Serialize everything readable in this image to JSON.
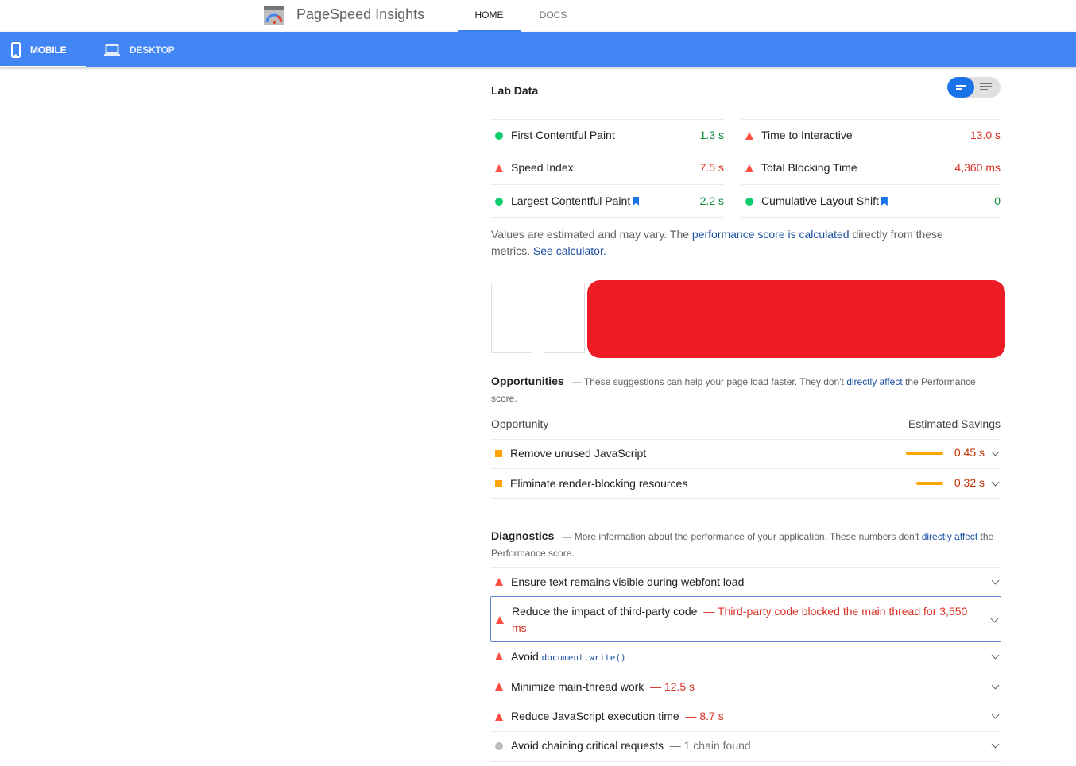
{
  "header": {
    "app_title": "PageSpeed Insights",
    "nav": [
      {
        "label": "HOME",
        "active": true
      },
      {
        "label": "DOCS",
        "active": false
      }
    ]
  },
  "device_tabs": [
    {
      "label": "MOBILE",
      "active": true,
      "icon": "phone-icon"
    },
    {
      "label": "DESKTOP",
      "active": false,
      "icon": "laptop-icon"
    }
  ],
  "lab_data": {
    "title": "Lab Data",
    "metrics": [
      {
        "label": "First Contentful Paint",
        "value": "1.3 s",
        "status": "pass",
        "bookmark": false
      },
      {
        "label": "Time to Interactive",
        "value": "13.0 s",
        "status": "fail",
        "bookmark": false
      },
      {
        "label": "Speed Index",
        "value": "7.5 s",
        "status": "fail",
        "bookmark": false
      },
      {
        "label": "Total Blocking Time",
        "value": "4,360 ms",
        "status": "fail",
        "bookmark": false
      },
      {
        "label": "Largest Contentful Paint",
        "value": "2.2 s",
        "status": "pass",
        "bookmark": true
      },
      {
        "label": "Cumulative Layout Shift",
        "value": "0",
        "status": "pass",
        "bookmark": true
      }
    ],
    "disclaimer": {
      "part1": "Values are estimated and may vary. The ",
      "link1": "performance score is calculated",
      "part2": " directly from these metrics. ",
      "link2": "See calculator."
    }
  },
  "opportunities": {
    "title": "Opportunities",
    "desc_part1": "— These suggestions can help your page load faster. They don't ",
    "desc_link": "directly affect",
    "desc_part2": " the Performance score.",
    "col_left": "Opportunity",
    "col_right": "Estimated Savings",
    "items": [
      {
        "label": "Remove unused JavaScript",
        "savings": "0.45 s",
        "bar_fraction": 1.0
      },
      {
        "label": "Eliminate render-blocking resources",
        "savings": "0.32 s",
        "bar_fraction": 0.72
      }
    ]
  },
  "diagnostics": {
    "title": "Diagnostics",
    "desc_part1": "— More information about the performance of your application. These numbers don't ",
    "desc_link": "directly affect",
    "desc_part2": " the Performance score.",
    "items": [
      {
        "label": "Ensure text remains visible during webfont load",
        "sub": "",
        "status": "fail"
      },
      {
        "label": "Reduce the impact of third-party code",
        "sub": "— Third-party code blocked the main thread for 3,550 ms",
        "status": "fail"
      },
      {
        "label": "Avoid",
        "code": "document.write()",
        "sub": "",
        "status": "fail"
      },
      {
        "label": "Minimize main-thread work",
        "sub": "— 12.5 s",
        "status": "fail"
      },
      {
        "label": "Reduce JavaScript execution time",
        "sub": "— 8.7 s",
        "status": "fail"
      },
      {
        "label": "Avoid chaining critical requests",
        "sub": "— 1 chain found",
        "status": "informative"
      }
    ]
  },
  "colors": {
    "brand_blue": "#4285f4",
    "pass": "#0cce6b",
    "fail": "#ff4e42",
    "average": "#ffa400",
    "redaction": "#ed1c24"
  }
}
